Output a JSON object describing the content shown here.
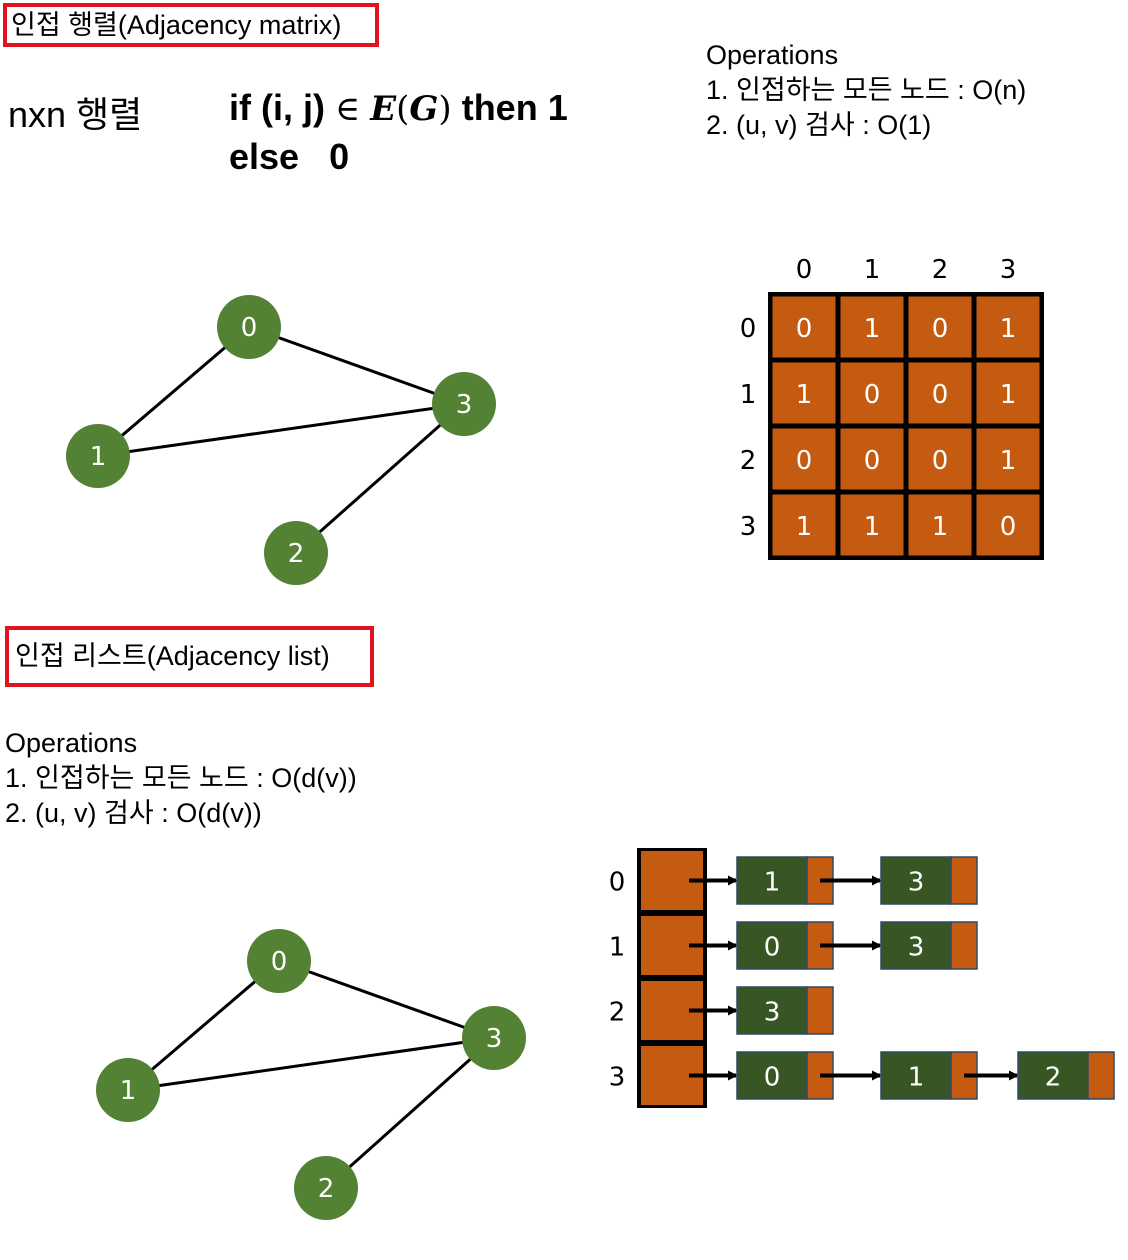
{
  "matrix_section": {
    "title": "인접 행렬(Adjacency matrix)",
    "nxn_label": "nxn 행렬",
    "formula": {
      "line1_if": "if (i, j)",
      "line1_elem": "∈",
      "line1_E": "E",
      "line1_paren_open": "(",
      "line1_G": "G",
      "line1_paren_close": ")",
      "line1_then": "then 1",
      "line2": "else   0"
    },
    "operations": {
      "header": "Operations",
      "items": [
        "1. 인접하는 모든 노드 : O(n)",
        "2. (u, v) 검사 : O(1)"
      ]
    },
    "matrix": {
      "col_labels": [
        "0",
        "1",
        "2",
        "3"
      ],
      "row_labels": [
        "0",
        "1",
        "2",
        "3"
      ],
      "values": [
        [
          "0",
          "1",
          "0",
          "1"
        ],
        [
          "1",
          "0",
          "0",
          "1"
        ],
        [
          "0",
          "0",
          "0",
          "1"
        ],
        [
          "1",
          "1",
          "1",
          "0"
        ]
      ]
    }
  },
  "list_section": {
    "title": "인접 리스트(Adjacency list)",
    "operations": {
      "header": "Operations",
      "items": [
        "1. 인접하는 모든 노드 : O(d(v))",
        "2. (u, v) 검사 : O(d(v))"
      ]
    },
    "adjacency_list": [
      {
        "vertex": "0",
        "neighbors": [
          "1",
          "3"
        ]
      },
      {
        "vertex": "1",
        "neighbors": [
          "0",
          "3"
        ]
      },
      {
        "vertex": "2",
        "neighbors": [
          "3"
        ]
      },
      {
        "vertex": "3",
        "neighbors": [
          "0",
          "1",
          "2"
        ]
      }
    ]
  },
  "graph": {
    "nodes": [
      "0",
      "1",
      "2",
      "3"
    ],
    "edges": [
      [
        "0",
        "1"
      ],
      [
        "0",
        "3"
      ],
      [
        "1",
        "3"
      ],
      [
        "2",
        "3"
      ]
    ]
  },
  "colors": {
    "node_fill": "#548235",
    "cell_fill": "#c55a11",
    "list_node_fill": "#375623",
    "title_border": "#e0141e"
  }
}
